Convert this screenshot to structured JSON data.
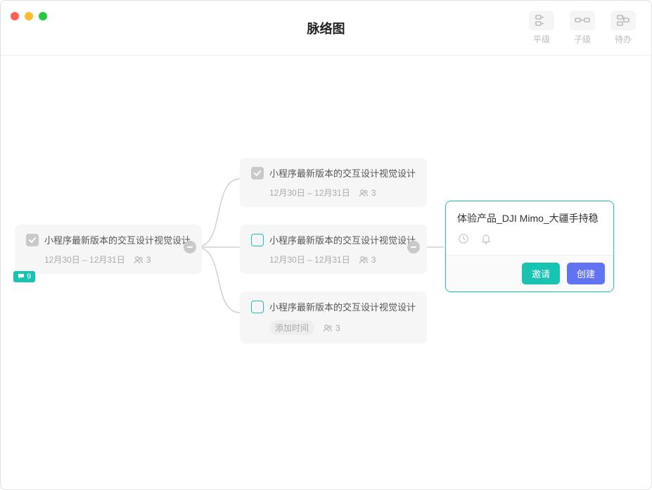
{
  "header": {
    "title": "脉络图",
    "tools": [
      {
        "name": "peer",
        "label": "平级"
      },
      {
        "name": "child",
        "label": "子级"
      },
      {
        "name": "todo",
        "label": "待办"
      }
    ]
  },
  "root": {
    "title": "小程序最新版本的交互设计视觉设计",
    "date": "12月30日 – 12月31日",
    "people": "3",
    "badge": "9",
    "checked": true
  },
  "children": [
    {
      "title": "小程序最新版本的交互设计视觉设计",
      "date": "12月30日 – 12月31日",
      "people": "3",
      "checked": true
    },
    {
      "title": "小程序最新版本的交互设计视觉设计",
      "date": "12月30日 – 12月31日",
      "people": "3",
      "checked": false
    },
    {
      "title": "小程序最新版本的交互设计视觉设计",
      "add_time": "添加时间",
      "people": "3",
      "checked": false
    }
  ],
  "panel": {
    "title": "体验产品_DJI Mimo_大疆手持稳",
    "invite": "邀请",
    "create": "创建"
  }
}
